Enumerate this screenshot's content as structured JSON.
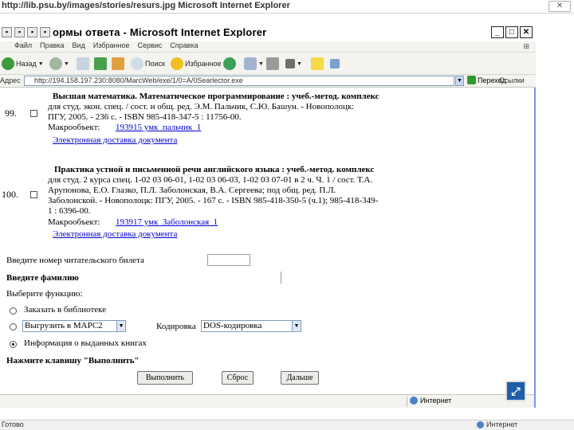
{
  "viewer": {
    "title": "http://lib.psu.by/images/stories/resurs.jpg   Microsoft Internet Explorer",
    "close_label": "✕"
  },
  "window": {
    "title": "ормы ответа - Microsoft Internet Explorer"
  },
  "menu": {
    "items": [
      "Файл",
      "Правка",
      "Вид",
      "Избранное",
      "Сервис",
      "Справка"
    ]
  },
  "toolbar": {
    "back": "Назад",
    "search": "Поиск",
    "favorites": "Избранное"
  },
  "address": {
    "label": "Адрес",
    "url": "http://194.158.197.230:8080/MarcWeb/exe/1/0=A/0Searlector.exe",
    "go": "Переход",
    "links": "Ссылки"
  },
  "records": [
    {
      "num": "99.",
      "lines": [
        "Высшая математика. Математическое программирование : учеб.-метод. комплекс",
        "для студ. экон. спец. / сост. и общ. ред. Э.М. Пальчик, С.Ю. Башун. - Новополоцк:",
        "ПГУ, 2005. - 236 с. - ISBN 985-418-347-5 : 11756-00."
      ],
      "macro_label": "Макрообъект:",
      "macro_link": "193915 умк_пальчик_1",
      "delivery": "Электронная доставка документа"
    },
    {
      "num": "100.",
      "lines": [
        "Практика устной и письменной речи английского языка : учеб.-метод. комплекс",
        "для студ. 2 курса спец. 1-02 03 06-01, 1-02 03 06-03, 1-02 03 07-01 в 2 ч. Ч. 1 / сост. Т.А.",
        "Арупонова, Е.О. Глазко, П.Л. Заболонская, В.А. Сергеева; под общ. ред. П.Л.",
        "Заболонской. - Новополоцк: ПГУ, 2005. - 167 с. - ISBN 985-418-350-5 (ч.1); 985-418-349-",
        "1 : 6396-00."
      ],
      "macro_label": "Макрообъект:",
      "macro_link": "193917 умк_Заболонская_1",
      "delivery": "Электронная доставка документа"
    }
  ],
  "form": {
    "card_label": "Введите номер читательского билета",
    "surname_label": "Введите фамилию",
    "function_label": "Выберите функцию:",
    "option_order": "Заказать в библиотеке",
    "export_select": "Выгрузить в МАРС2",
    "encoding_label": "Кодировка",
    "encoding_select": "DOS-кодировка",
    "option_info": "Информация о выданных книгах",
    "press_label": "Нажмите клавишу \"Выполнить\"",
    "execute_button": "Выполнить",
    "reset_button": "Сброс",
    "next_button": "Дальше"
  },
  "status": {
    "zone": "Интернет"
  },
  "taskbar": {
    "left": "Готово",
    "right": "Интернет"
  }
}
